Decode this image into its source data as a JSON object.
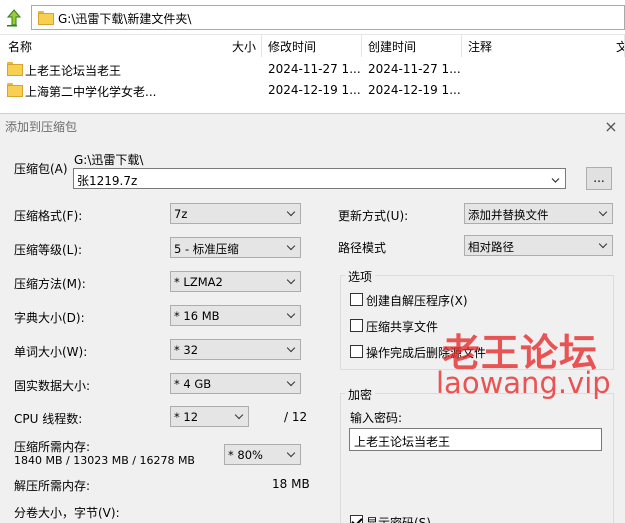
{
  "explorer": {
    "address": "G:\\迅雷下载\\新建文件夹\\",
    "columns": [
      "名称",
      "大小",
      "修改时间",
      "创建时间",
      "注释",
      "文"
    ],
    "rows": [
      {
        "name": "上老王论坛当老王",
        "size": "",
        "modified": "2024-11-27 1...",
        "created": "2024-11-27 1..."
      },
      {
        "name": "上海第二中学化学女老...",
        "size": "",
        "modified": "2024-12-19 1...",
        "created": "2024-12-19 1..."
      }
    ]
  },
  "dialog": {
    "title": "添加到压缩包",
    "close_glyph": "×",
    "archive_label": "压缩包(A)",
    "archive_dir": "G:\\迅雷下载\\",
    "archive_name": "张1219.7z",
    "browse_label": "...",
    "format_label": "压缩格式(F):",
    "format_value": "7z",
    "level_label": "压缩等级(L):",
    "level_value": "5 - 标准压缩",
    "method_label": "压缩方法(M):",
    "method_value": "*  LZMA2",
    "dict_label": "字典大小(D):",
    "dict_value": "*  16 MB",
    "word_label": "单词大小(W):",
    "word_value": "*  32",
    "solid_label": "固实数据大小:",
    "solid_value": "*  4 GB",
    "cpu_label": "CPU 线程数:",
    "cpu_value": "*  12",
    "cpu_total": "/ 12",
    "mem_comp_label": "压缩所需内存:",
    "mem_comp_detail": "1840 MB / 13023 MB / 16278 MB",
    "mem_comp_value": "*  80%",
    "mem_decomp_label": "解压所需内存:",
    "mem_decomp_value": "18 MB",
    "split_label": "分卷大小，字节(V):",
    "update_label": "更新方式(U):",
    "update_value": "添加并替换文件",
    "path_label": "路径模式",
    "path_value": "相对路径",
    "options_title": "选项",
    "opt_sfx": "创建自解压程序(X)",
    "opt_shared": "压缩共享文件",
    "opt_delete": "操作完成后删除源文件",
    "encrypt_title": "加密",
    "pw_label": "输入密码:",
    "pw_value": "上老王论坛当老王",
    "show_pw": "显示密码(S)"
  },
  "watermark": {
    "cn": "老王论坛",
    "en": "laowang.vip"
  }
}
